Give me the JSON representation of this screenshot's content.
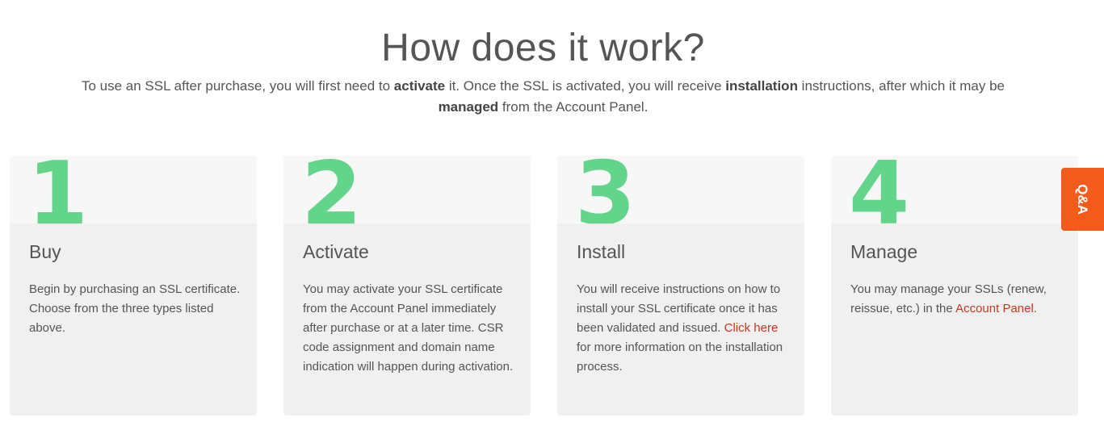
{
  "header": {
    "title": "How does it work?",
    "intro": [
      {
        "text": "To use an SSL after purchase, you will first need to ",
        "bold": false
      },
      {
        "text": "activate",
        "bold": true
      },
      {
        "text": " it. Once the SSL is activated, you will receive ",
        "bold": false
      },
      {
        "text": "installation",
        "bold": true
      },
      {
        "text": " instructions, after which it may be ",
        "bold": false
      },
      {
        "text": "managed",
        "bold": true
      },
      {
        "text": " from the Account Panel.",
        "bold": false
      }
    ]
  },
  "steps": [
    {
      "number": "1",
      "title": "Buy",
      "body": [
        {
          "text": "Begin by purchasing an SSL certificate. Choose from the three types listed above.",
          "link": false
        }
      ]
    },
    {
      "number": "2",
      "title": "Activate",
      "body": [
        {
          "text": "You may activate your SSL certificate from the Account Panel immediately after purchase or at a later time. CSR code assignment and domain name indication will happen during activation.",
          "link": false
        }
      ]
    },
    {
      "number": "3",
      "title": "Install",
      "body": [
        {
          "text": "You will receive instructions on how to install your SSL certificate once it has been validated and issued. ",
          "link": false
        },
        {
          "text": "Click here",
          "link": true
        },
        {
          "text": " for more information on the installation process.",
          "link": false
        }
      ]
    },
    {
      "number": "4",
      "title": "Manage",
      "body": [
        {
          "text": "You may manage your SSLs (renew, reissue, etc.) in the ",
          "link": false
        },
        {
          "text": "Account Panel.",
          "link": true
        }
      ]
    }
  ],
  "qa_tab": {
    "label": "Q&A"
  },
  "colors": {
    "accent_green": "#63d58a",
    "link_red": "#d0331f",
    "qa_orange": "#f25b1c"
  }
}
